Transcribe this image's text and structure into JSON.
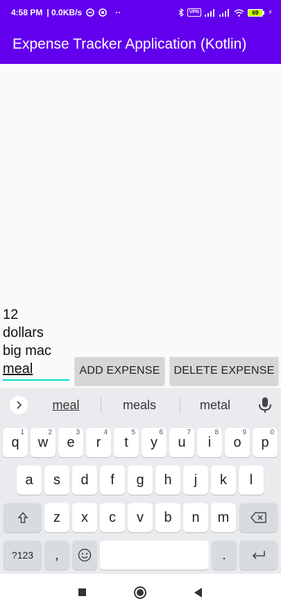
{
  "status_bar": {
    "time": "4:58 PM",
    "net_speed": "| 0.0KB/s",
    "dots": "··",
    "vpn": "VPN",
    "battery": "69",
    "lightning": "⚡"
  },
  "app_bar": {
    "title": "Expense Tracker Application (Kotlin)"
  },
  "entries": [
    "12",
    "dollars",
    "big mac"
  ],
  "input": {
    "value": "meal"
  },
  "buttons": {
    "add": "ADD EXPENSE",
    "delete": "DELETE EXPENSE"
  },
  "keyboard": {
    "suggestions": [
      "meal",
      "meals",
      "metal"
    ],
    "row1": [
      {
        "k": "q",
        "h": "1"
      },
      {
        "k": "w",
        "h": "2"
      },
      {
        "k": "e",
        "h": "3"
      },
      {
        "k": "r",
        "h": "4"
      },
      {
        "k": "t",
        "h": "5"
      },
      {
        "k": "y",
        "h": "6"
      },
      {
        "k": "u",
        "h": "7"
      },
      {
        "k": "i",
        "h": "8"
      },
      {
        "k": "o",
        "h": "9"
      },
      {
        "k": "p",
        "h": "0"
      }
    ],
    "row2": [
      "a",
      "s",
      "d",
      "f",
      "g",
      "h",
      "j",
      "k",
      "l"
    ],
    "row3": [
      "z",
      "x",
      "c",
      "v",
      "b",
      "n",
      "m"
    ],
    "symbols_key": "?123",
    "comma_key": ",",
    "period_key": "."
  },
  "colors": {
    "primary": "#6200ee",
    "accent": "#03dac5",
    "button_bg": "#d6d6d6"
  }
}
